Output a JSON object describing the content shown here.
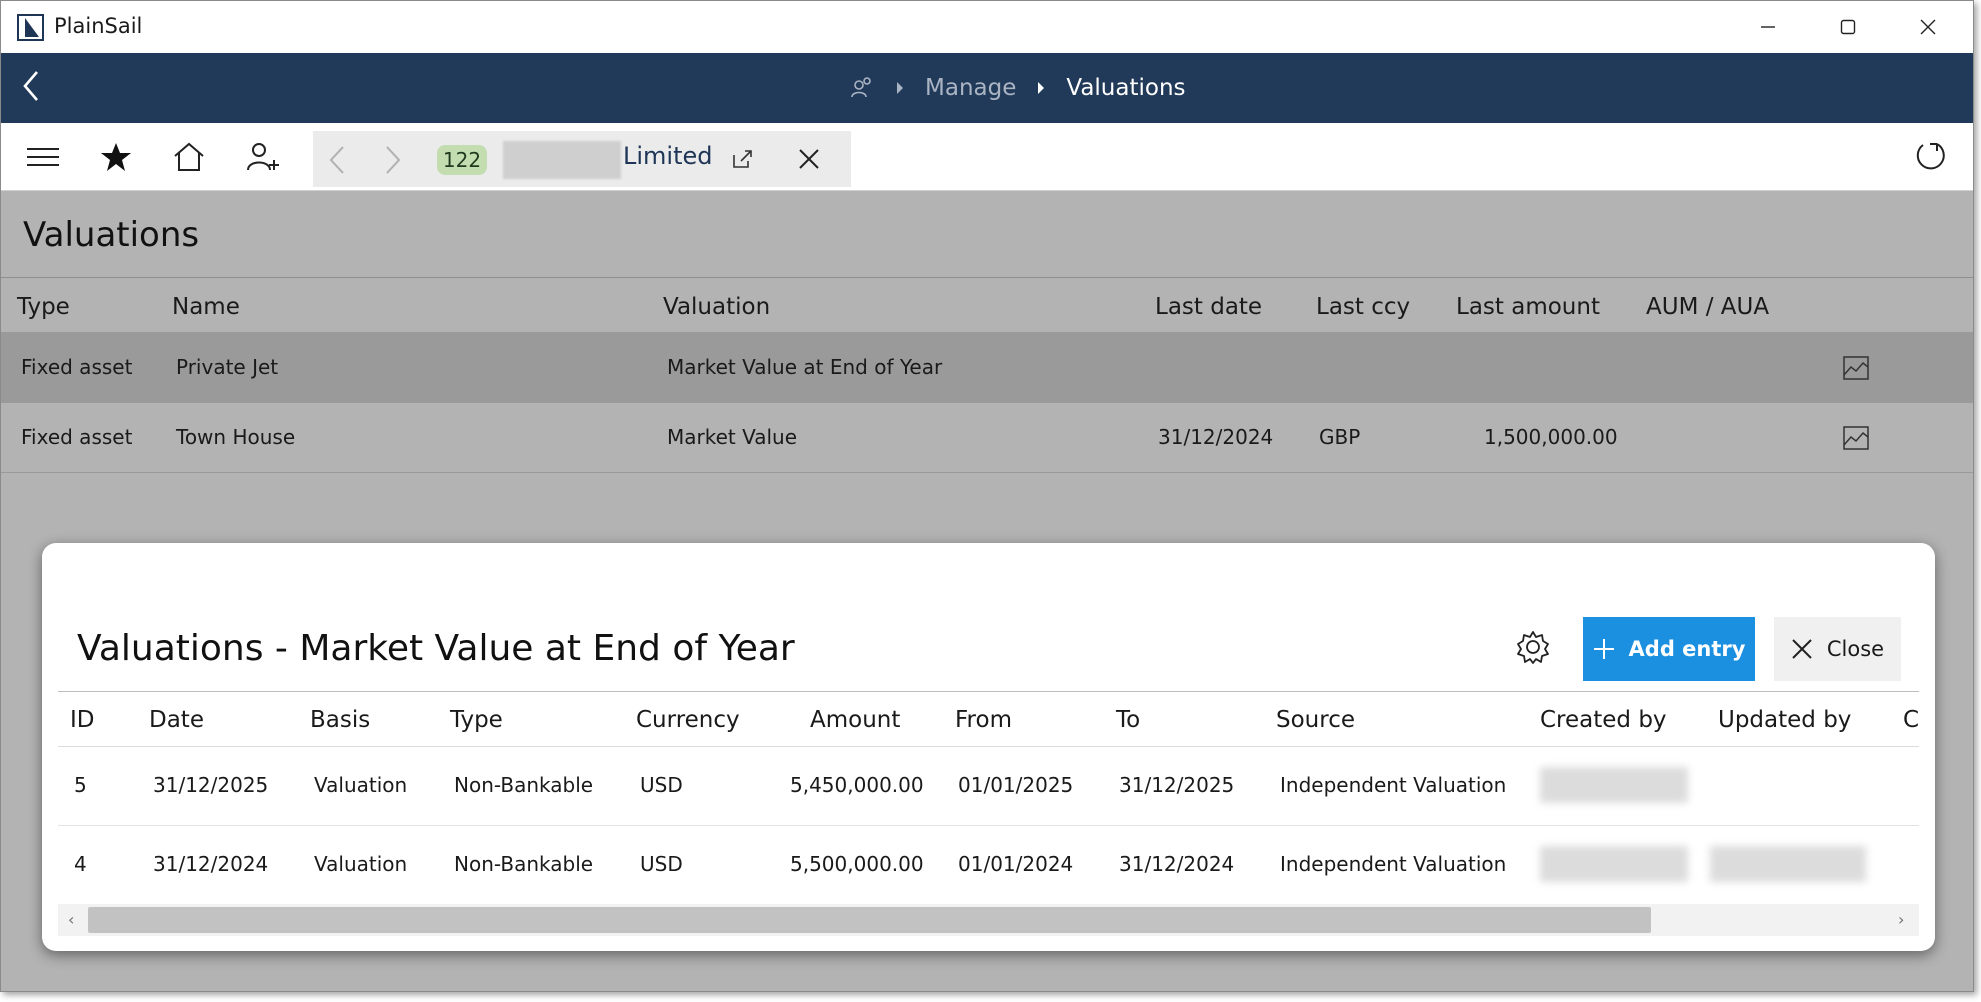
{
  "window": {
    "app_title": "PlainSail"
  },
  "navbar": {
    "breadcrumb": {
      "manage": "Manage",
      "current": "Valuations"
    }
  },
  "toolbar": {
    "record_count": "122",
    "record_name": "Limited"
  },
  "page": {
    "title": "Valuations"
  },
  "main_table": {
    "headers": [
      "Type",
      "Name",
      "Valuation",
      "Last date",
      "Last ccy",
      "Last amount",
      "AUM / AUA"
    ],
    "rows": [
      {
        "type": "Fixed asset",
        "name": "Private Jet",
        "valuation": "Market Value at End of Year",
        "last_date": "",
        "last_ccy": "",
        "last_amount": ""
      },
      {
        "type": "Fixed asset",
        "name": "Town House",
        "valuation": "Market Value",
        "last_date": "31/12/2024",
        "last_ccy": "GBP",
        "last_amount": "1,500,000.00"
      }
    ],
    "selected_row": 0
  },
  "modal": {
    "title": "Valuations - Market Value at End of Year",
    "add_entry_label": "Add entry",
    "close_label": "Close",
    "headers": [
      "ID",
      "Date",
      "Basis",
      "Type",
      "Currency",
      "Amount",
      "From",
      "To",
      "Source",
      "Created by",
      "Updated by",
      "C"
    ],
    "rows": [
      {
        "id": "5",
        "date": "31/12/2025",
        "basis": "Valuation",
        "type": "Non-Bankable",
        "currency": "USD",
        "amount": "5,450,000.00",
        "from": "01/01/2025",
        "to": "31/12/2025",
        "source": "Independent Valuation"
      },
      {
        "id": "4",
        "date": "31/12/2024",
        "basis": "Valuation",
        "type": "Non-Bankable",
        "currency": "USD",
        "amount": "5,500,000.00",
        "from": "01/01/2024",
        "to": "31/12/2024",
        "source": "Independent Valuation"
      }
    ],
    "scroll_fraction": 0.0
  },
  "colors": {
    "navbar": "#213a59",
    "accent": "#1b90e0",
    "badge": "#c3dcb0",
    "overlay": "#b3b3b3"
  },
  "icons": [
    "app-logo-icon",
    "minimize-icon",
    "maximize-icon",
    "close-icon",
    "back-icon",
    "people-icon",
    "chevron-right-icon",
    "menu-icon",
    "star-icon",
    "home-icon",
    "add-person-icon",
    "chevron-left-icon",
    "open-external-icon",
    "refresh-icon",
    "chart-icon",
    "gear-icon",
    "plus-icon"
  ]
}
